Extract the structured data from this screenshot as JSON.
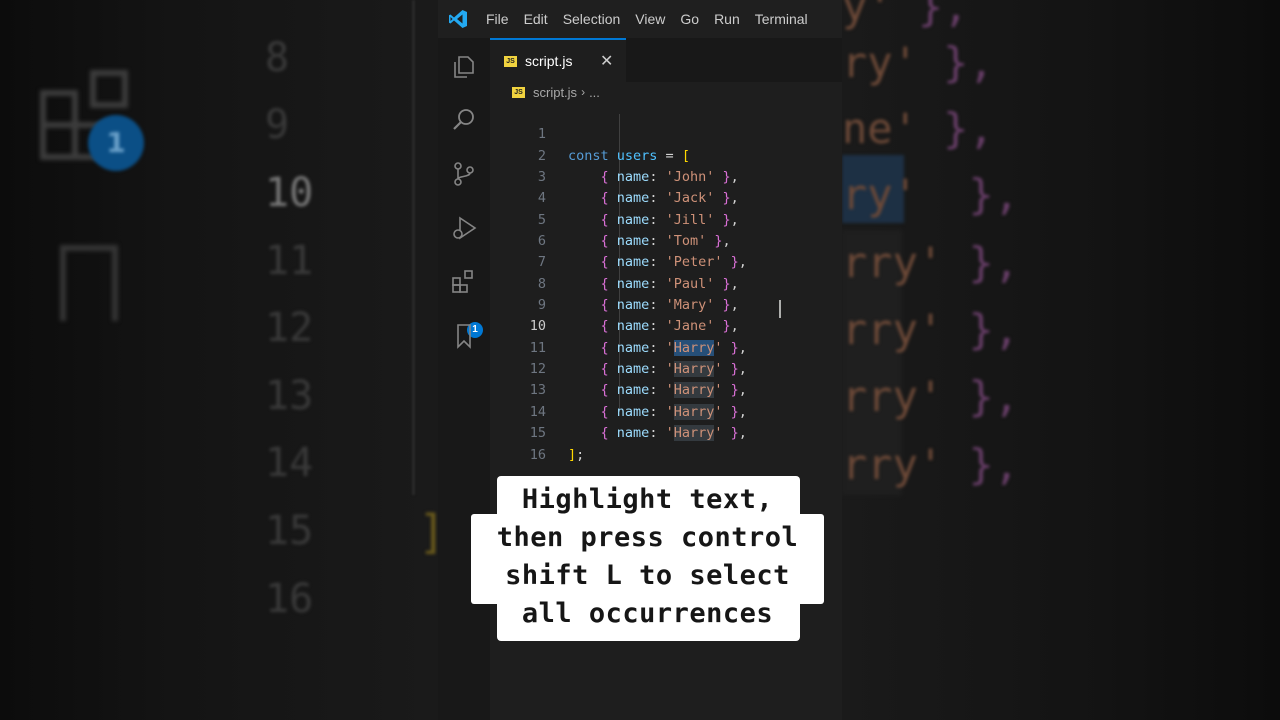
{
  "menubar": {
    "items": [
      "File",
      "Edit",
      "Selection",
      "View",
      "Go",
      "Run",
      "Terminal"
    ]
  },
  "activity_bar": {
    "icons": [
      "explorer-icon",
      "search-icon",
      "source-control-icon",
      "run-debug-icon",
      "extensions-icon",
      "bookmarks-icon"
    ],
    "extensions_badge": "1"
  },
  "tab": {
    "icon_text": "JS",
    "label": "script.js",
    "close": "✕"
  },
  "breadcrumb": {
    "file": "script.js",
    "separator": "›",
    "rest": "..."
  },
  "editor": {
    "active_line": 10,
    "line_numbers": [
      "1",
      "2",
      "3",
      "4",
      "5",
      "6",
      "7",
      "8",
      "9",
      "10",
      "11",
      "12",
      "13",
      "14",
      "15",
      "16"
    ],
    "names": [
      "John",
      "Jack",
      "Jill",
      "Tom",
      "Peter",
      "Paul",
      "Mary",
      "Jane",
      "Harry",
      "Harry",
      "Harry",
      "Harry",
      "Harry"
    ],
    "highlighted_word": "Harry"
  },
  "caption": {
    "lines": [
      "Highlight text,",
      "then press control",
      "shift L to select",
      "all occurrences"
    ]
  },
  "colors": {
    "editor_bg": "#1e1e1e",
    "accent": "#0078d4",
    "string": "#ce9178",
    "keyword": "#569cd6",
    "property": "#9cdcfe"
  }
}
